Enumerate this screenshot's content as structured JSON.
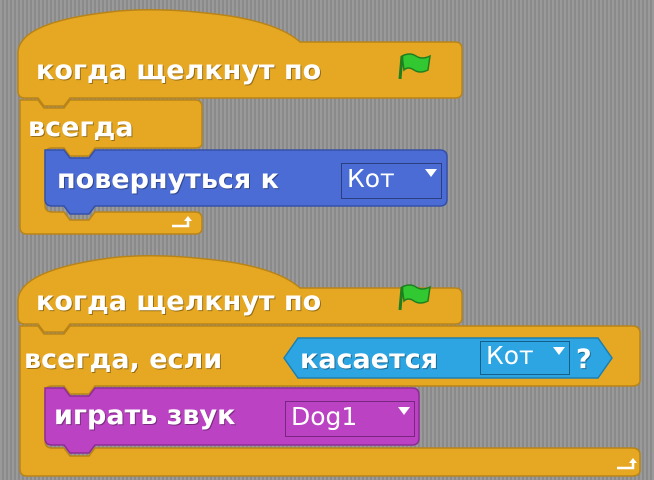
{
  "script1": {
    "hat_label": "когда щелкнут по",
    "forever_label": "всегда",
    "turn_label": "повернуться к",
    "turn_target": "Кот"
  },
  "script2": {
    "hat_label": "когда щелкнут по",
    "forever_if_label": "всегда, если",
    "touching_label": "касается",
    "touching_target": "Кот",
    "question_mark": "?",
    "play_sound_label": "играть звук",
    "sound_name": "Dog1"
  },
  "colors": {
    "control": "#E6A822",
    "motion": "#4A6CD4",
    "sensing": "#2CA5E2",
    "sound": "#BB42C3",
    "flag": "#32C832"
  },
  "icons": [
    "green-flag-icon",
    "loop-arrow-icon",
    "dropdown-arrow-icon"
  ]
}
